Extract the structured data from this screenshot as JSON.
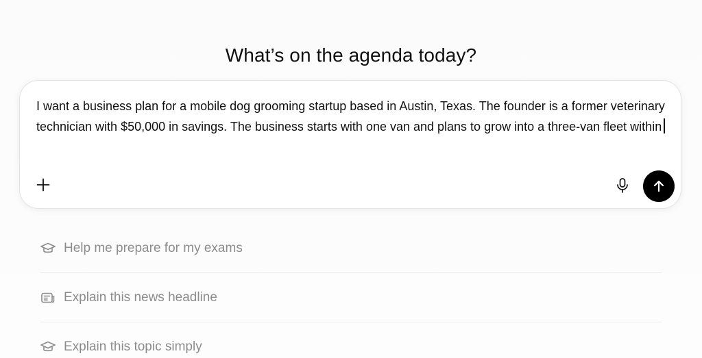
{
  "heading": "What’s on the agenda today?",
  "composer": {
    "text": "I want a business plan for a mobile dog grooming startup based in Austin, Texas. The founder is a former veterinary technician with $50,000 in savings. The business starts with one van and plans to grow into a three-van fleet within",
    "icons": {
      "add": "plus-icon",
      "voice": "microphone-icon",
      "send": "arrow-up-icon"
    }
  },
  "suggestions": [
    {
      "label": "Help me prepare for my exams",
      "icon": "graduation-cap-icon"
    },
    {
      "label": "Explain this news headline",
      "icon": "newspaper-icon"
    },
    {
      "label": "Explain this topic simply",
      "icon": "graduation-cap-icon"
    }
  ],
  "colors": {
    "send_button": "#000000",
    "suggestion_text": "#8c8c8c"
  }
}
